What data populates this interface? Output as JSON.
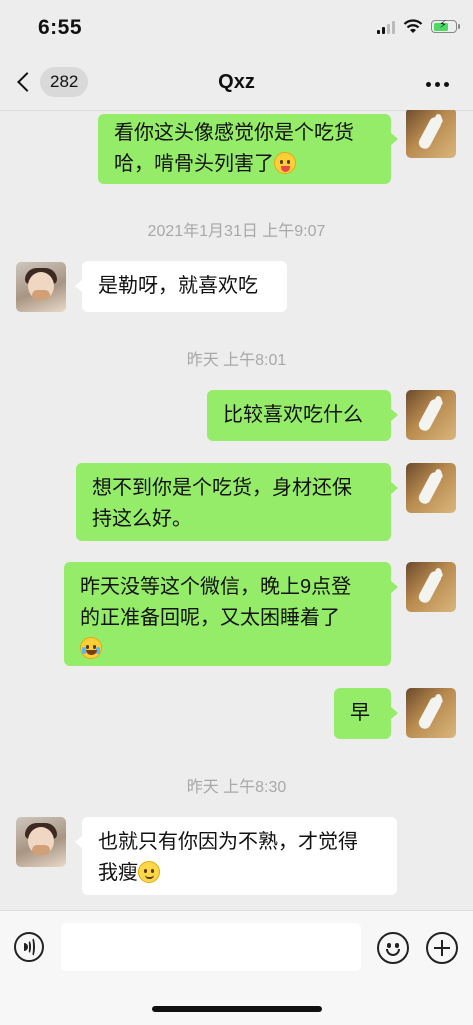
{
  "status_bar": {
    "time": "6:55",
    "icons": [
      "signal-icon",
      "wifi-icon",
      "battery-charging-icon"
    ]
  },
  "header": {
    "unread_count": "282",
    "title": "Qxz",
    "icons": [
      "back-chevron-icon",
      "more-icon"
    ]
  },
  "chat": {
    "messages": [
      {
        "side": "self",
        "lines": [
          "看你这头像感觉你是个吃货",
          "哈，啃骨头列害了"
        ],
        "emoji": "tongue-face-emoji"
      },
      {
        "type": "timestamp",
        "text": "2021年1月31日 上午9:07"
      },
      {
        "side": "other",
        "text": "是勒呀，就喜欢吃"
      },
      {
        "type": "timestamp",
        "text": "昨天 上午8:01"
      },
      {
        "side": "self",
        "text": "比较喜欢吃什么"
      },
      {
        "side": "self",
        "lines": [
          "想不到你是个吃货，身材还保",
          "持这么好。"
        ]
      },
      {
        "side": "self",
        "lines": [
          "昨天没等这个微信，晚上9点登",
          "的正准备回呢，又太困睡着了"
        ],
        "emoji": "tears-of-joy-emoji"
      },
      {
        "side": "self",
        "text": "早"
      },
      {
        "type": "timestamp",
        "text": "昨天 上午8:30"
      },
      {
        "side": "other",
        "lines": [
          "也就只有你因为不熟，才觉得",
          "我瘦"
        ],
        "emoji": "smile-emoji"
      }
    ]
  },
  "input_bar": {
    "placeholder": "",
    "icons": [
      "voice-icon",
      "emoji-icon",
      "plus-icon"
    ]
  },
  "colors": {
    "background": "#ededed",
    "self_bubble": "#95ec69",
    "other_bubble": "#ffffff",
    "timestamp_text": "#a8a8a8"
  }
}
